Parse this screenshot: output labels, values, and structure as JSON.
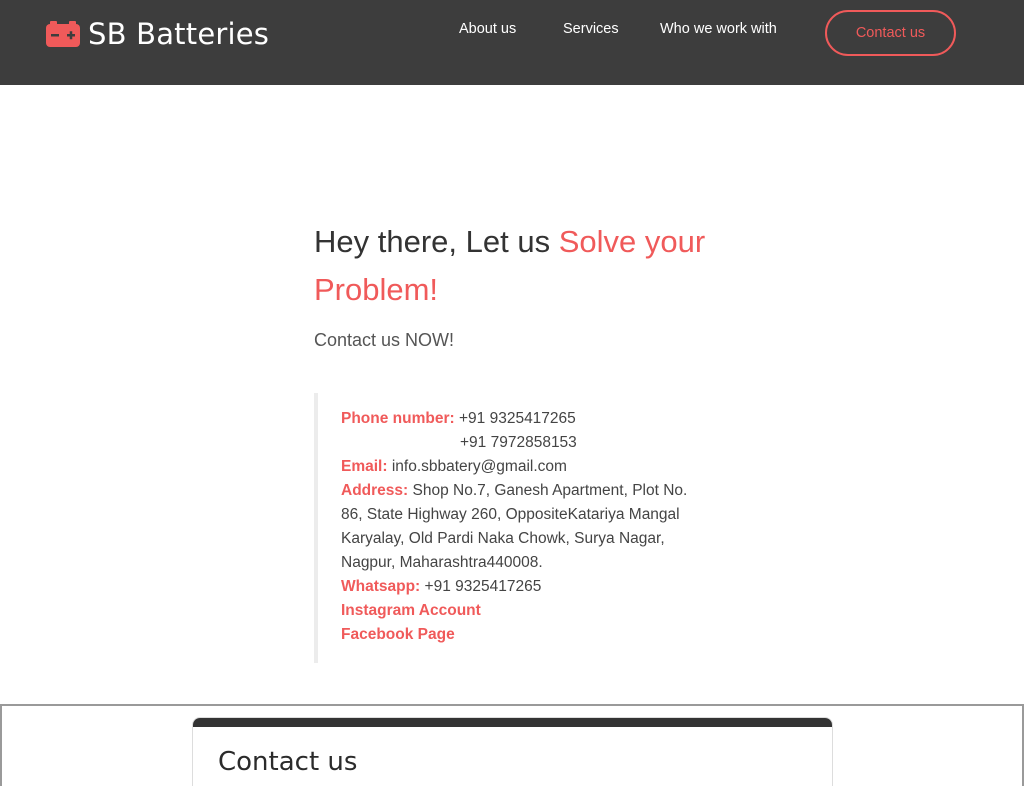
{
  "header": {
    "brand": "SB Batteries",
    "brand_icon": "battery-icon",
    "nav": [
      {
        "label": "About us"
      },
      {
        "label": "Services"
      },
      {
        "label": "Who we work with"
      }
    ],
    "cta": "Contact us"
  },
  "hero": {
    "title_plain": "Hey there, Let us ",
    "title_highlight": "Solve your Problem!",
    "subtitle": "Contact us NOW!"
  },
  "contact_info": {
    "phone_label": "Phone number:",
    "phone_1": "+91 9325417265",
    "phone_2": "+91 7972858153",
    "email_label": "Email:",
    "email": "info.sbbatery@gmail.com",
    "address_label": "Address:",
    "address": "Shop No.7, Ganesh Apartment, Plot No. 86, State Highway 260, OppositeKatariya Mangal Karyalay, Old Pardi Naka Chowk, Surya Nagar, Nagpur, Maharashtra440008.",
    "whatsapp_label": "Whatsapp:",
    "whatsapp": "+91 9325417265",
    "instagram": "Instagram Account",
    "facebook": "Facebook Page"
  },
  "contact_section": {
    "title": "Contact us"
  },
  "colors": {
    "accent": "#f05a5a",
    "header_bg": "#3d3d3d",
    "text": "#333333"
  }
}
